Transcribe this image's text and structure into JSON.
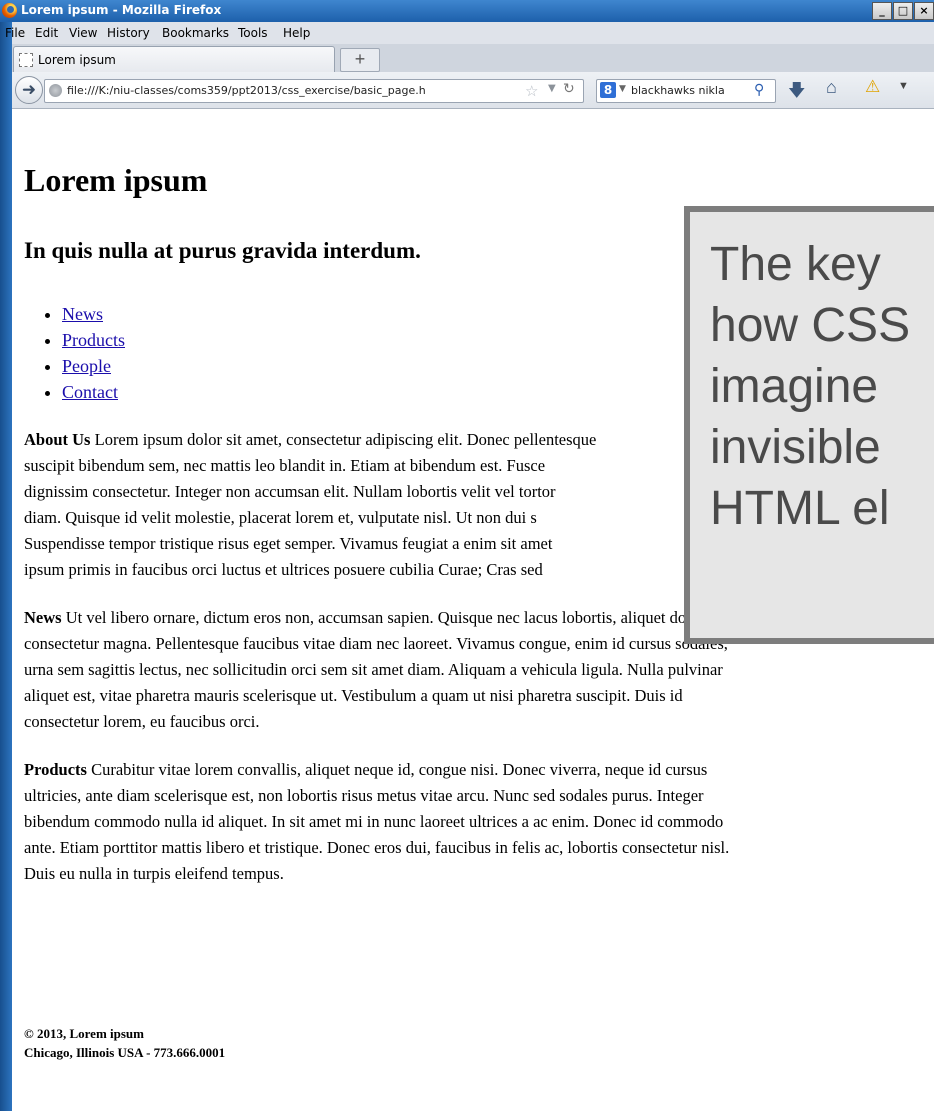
{
  "window": {
    "title": "Lorem ipsum - Mozilla Firefox",
    "minimize": "_",
    "maximize": "□",
    "close": "×"
  },
  "menubar": {
    "items": [
      {
        "label": "File"
      },
      {
        "label": "Edit"
      },
      {
        "label": "View"
      },
      {
        "label": "History"
      },
      {
        "label": "Bookmarks"
      },
      {
        "label": "Tools"
      },
      {
        "label": "Help"
      }
    ]
  },
  "tabs": [
    {
      "label": "Lorem ipsum",
      "active": true
    }
  ],
  "new_tab_glyph": "+",
  "navbar": {
    "url": "file:///K:/niu-classes/coms359/ppt2013/css_exercise/basic_page.h",
    "search_engine_glyph": "8",
    "search_value": "blackhawks nikla",
    "icons": [
      "back-icon",
      "globe-icon",
      "star-icon",
      "dropdown-icon",
      "reload-icon",
      "search-icon",
      "download-icon",
      "home-icon",
      "warning-icon",
      "menu-icon"
    ]
  },
  "page": {
    "title": "Lorem ipsum",
    "subtitle": "In quis nulla at purus gravida interdum.",
    "nav_links": [
      "News",
      "Products",
      "People",
      "Contact"
    ],
    "paragraphs": [
      {
        "heading": "About Us",
        "lines": [
          "Lorem ipsum dolor sit amet, consectetur adipiscing elit. Donec pellentesque",
          "suscipit bibendum sem, nec mattis leo blandit in. Etiam at bibendum est. Fusce",
          "dignissim consectetur. Integer non accumsan elit. Nullam lobortis velit vel tortor",
          "diam. Quisque id velit molestie, placerat lorem et, vulputate nisl. Ut non dui s",
          "Suspendisse tempor tristique risus eget semper. Vivamus feugiat a enim sit amet",
          "ipsum primis in faucibus orci luctus et ultrices posuere cubilia Curae; Cras sed"
        ]
      },
      {
        "heading": "News",
        "lines": [
          "Ut vel libero ornare, dictum eros non, accumsan sapien. Quisque nec lacus lobortis, aliquet dolor in,",
          "consectetur magna. Pellentesque faucibus vitae diam nec laoreet. Vivamus congue, enim id cursus sodales,",
          "urna sem sagittis lectus, nec sollicitudin orci sem sit amet diam. Aliquam a vehicula ligula. Nulla pulvinar",
          "aliquet est, vitae pharetra mauris scelerisque ut. Vestibulum a quam ut nisi pharetra suscipit. Duis id",
          "consectetur lorem, eu faucibus orci."
        ]
      },
      {
        "heading": "Products",
        "lines": [
          "Curabitur vitae lorem convallis, aliquet neque id, congue nisi. Donec viverra, neque id cursus",
          "ultricies, ante diam scelerisque est, non lobortis risus metus vitae arcu. Nunc sed sodales purus. Integer",
          "bibendum commodo nulla id aliquet. In sit amet mi in nunc laoreet ultrices a ac enim. Donec id commodo",
          "ante. Etiam porttitor mattis libero et tristique. Donec eros dui, faucibus in felis ac, lobortis consectetur nisl.",
          "Duis eu nulla in turpis eleifend tempus."
        ]
      }
    ],
    "footer": {
      "line1": "© 2013, Lorem ipsum",
      "line2": "Chicago, Illinois USA - 773.666.0001"
    }
  },
  "callout": {
    "lines": [
      "The key",
      "how CSS",
      "imagine",
      "invisible",
      "HTML el"
    ]
  },
  "colors": {
    "window_frame": "#1c5fa6",
    "link": "#1a0dab",
    "callout_bg": "#e6e6e6",
    "callout_border": "#7d7d7d",
    "callout_text": "#4a4a4a"
  }
}
